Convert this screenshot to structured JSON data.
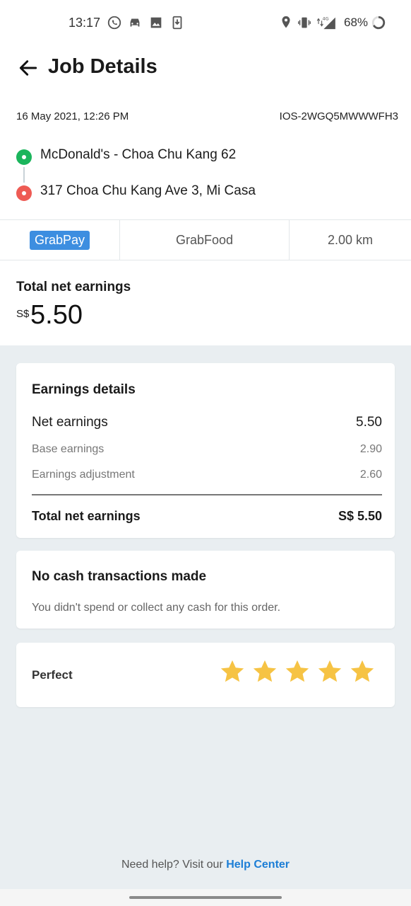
{
  "status_bar": {
    "time": "13:17",
    "battery": "68%",
    "icons": [
      "whatsapp-icon",
      "car-icon",
      "image-icon",
      "download-icon",
      "location-icon",
      "vibrate-icon",
      "signal-4g-icon",
      "battery-icon"
    ]
  },
  "header": {
    "title": "Job Details"
  },
  "job": {
    "date": "16 May 2021, 12:26 PM",
    "id": "IOS-2WGQ5MWWWFH3",
    "pickup": "McDonald's - Choa Chu Kang 62",
    "dropoff": "317 Choa Chu Kang Ave 3, Mi Casa"
  },
  "tags": {
    "payment": "GrabPay",
    "service": "GrabFood",
    "distance": "2.00 km"
  },
  "summary": {
    "label": "Total net earnings",
    "currency": "S$",
    "value": "5.50"
  },
  "earnings": {
    "title": "Earnings details",
    "net_label": "Net earnings",
    "net_value": "5.50",
    "base_label": "Base earnings",
    "base_value": "2.90",
    "adj_label": "Earnings adjustment",
    "adj_value": "2.60",
    "total_label": "Total net earnings",
    "total_value": "S$ 5.50"
  },
  "cash": {
    "title": "No cash transactions made",
    "subtitle": "You didn't spend or collect any cash for this order."
  },
  "rating": {
    "label": "Perfect",
    "stars": 5,
    "max_stars": 5,
    "star_color": "#f6c344"
  },
  "help": {
    "text": "Need help? Visit our ",
    "link": "Help Center"
  },
  "colors": {
    "accent": "#1c7ed6",
    "badge": "#3d8ee0",
    "pickup": "#1bb55c",
    "dropoff": "#ee5b54"
  }
}
